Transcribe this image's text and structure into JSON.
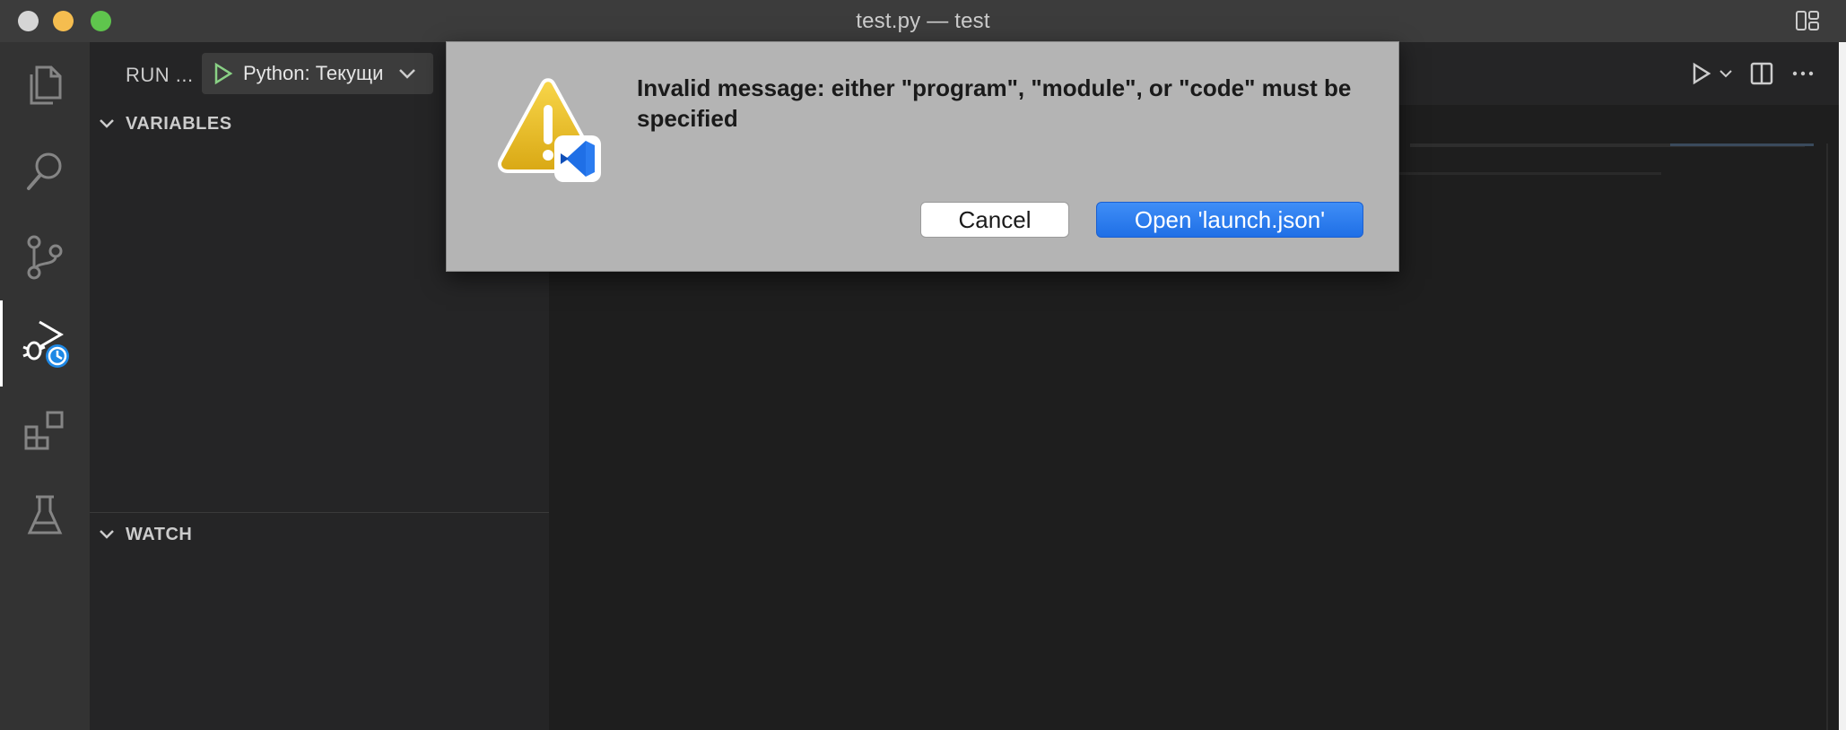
{
  "window": {
    "title": "test.py — test"
  },
  "activitybar": {
    "items": [
      {
        "name": "explorer",
        "icon": "files-icon"
      },
      {
        "name": "search",
        "icon": "search-icon"
      },
      {
        "name": "source-control",
        "icon": "source-control-icon"
      },
      {
        "name": "run-and-debug",
        "icon": "run-debug-icon",
        "active": true
      },
      {
        "name": "extensions",
        "icon": "extensions-icon"
      },
      {
        "name": "testing",
        "icon": "flask-icon"
      }
    ]
  },
  "sidebar": {
    "run_label": "RUN ...",
    "config_select": {
      "value": "Python: Текущи"
    },
    "sections": [
      {
        "title": "VARIABLES"
      },
      {
        "title": "WATCH"
      }
    ]
  },
  "dialog": {
    "message": "Invalid message: either \"program\", \"module\", or \"code\" must be specified",
    "cancel_label": "Cancel",
    "primary_label": "Open 'launch.json'"
  },
  "colors": {
    "accent_blue": "#2b7cf0",
    "play_green": "#89d185",
    "warning_yellow": "#f0c419"
  }
}
